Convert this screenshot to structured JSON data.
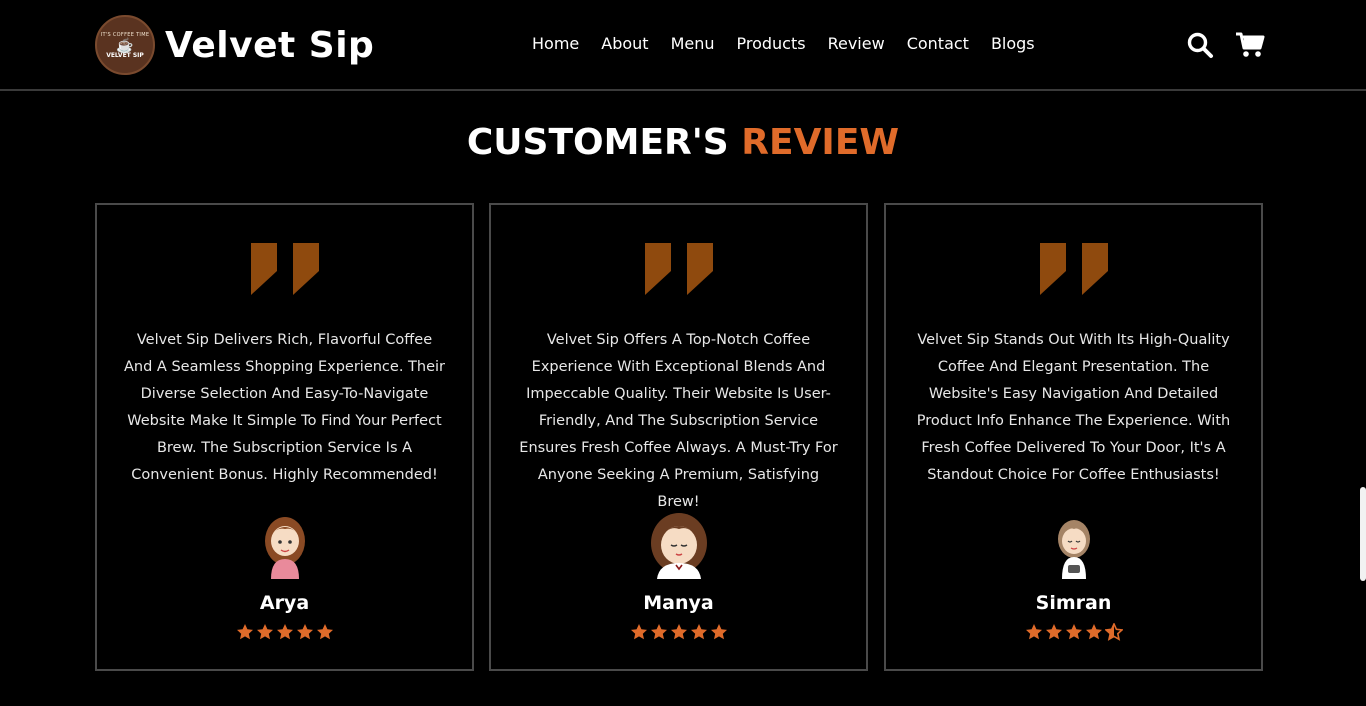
{
  "brand": {
    "name": "Velvet Sip",
    "badge_top": "IT'S COFFEE TIME",
    "badge_name": "VELVET SIP"
  },
  "nav": [
    "Home",
    "About",
    "Menu",
    "Products",
    "Review",
    "Contact",
    "Blogs"
  ],
  "icons": {
    "search": "search-icon",
    "cart": "cart-icon"
  },
  "colors": {
    "accent": "#e06b2a",
    "quote": "#8f4a0e",
    "star": "#e06b2a",
    "border": "#4a4a4a"
  },
  "section": {
    "title_main": "CUSTOMER'S",
    "title_accent": "REVIEW"
  },
  "reviews": [
    {
      "text": "Velvet Sip Delivers Rich, Flavorful Coffee And A Seamless Shopping Experience. Their Diverse Selection And Easy-To-Navigate Website Make It Simple To Find Your Perfect Brew. The Subscription Service Is A Convenient Bonus. Highly Recommended!",
      "name": "Arya",
      "rating": 5
    },
    {
      "text": "Velvet Sip Offers A Top-Notch Coffee Experience With Exceptional Blends And Impeccable Quality. Their Website Is User-Friendly, And The Subscription Service Ensures Fresh Coffee Always. A Must-Try For Anyone Seeking A Premium, Satisfying Brew!",
      "name": "Manya",
      "rating": 5
    },
    {
      "text": "Velvet Sip Stands Out With Its High-Quality Coffee And Elegant Presentation. The Website's Easy Navigation And Detailed Product Info Enhance The Experience. With Fresh Coffee Delivered To Your Door, It's A Standout Choice For Coffee Enthusiasts!",
      "name": "Simran",
      "rating": 4.5
    }
  ]
}
